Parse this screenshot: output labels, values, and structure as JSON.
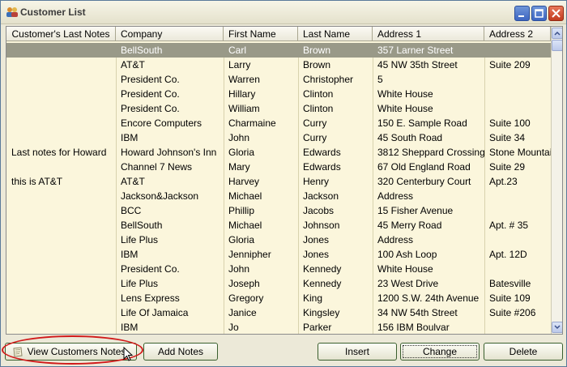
{
  "window": {
    "title": "Customer List"
  },
  "columns": [
    "Customer's Last Notes",
    "Company",
    "First Name",
    "Last Name",
    "Address 1",
    "Address 2"
  ],
  "rows": [
    [
      "",
      "BellSouth",
      "Carl",
      "Brown",
      "357 Larner Street",
      ""
    ],
    [
      "",
      "AT&T",
      "Larry",
      "Brown",
      "45 NW 35th Street",
      "Suite 209"
    ],
    [
      "",
      "President Co.",
      "Warren",
      "Christopher",
      "5",
      ""
    ],
    [
      "",
      "President Co.",
      "Hillary",
      "Clinton",
      "White House",
      ""
    ],
    [
      "",
      "President Co.",
      "William",
      "Clinton",
      "White House",
      ""
    ],
    [
      "",
      "Encore Computers",
      "Charmaine",
      "Curry",
      "150 E. Sample Road",
      "Suite 100"
    ],
    [
      "",
      "IBM",
      "John",
      "Curry",
      "45 South Road",
      "Suite 34"
    ],
    [
      "Last notes for Howard",
      "Howard Johnson's Inn",
      "Gloria",
      "Edwards",
      "3812 Sheppard Crossing",
      "Stone Mountain"
    ],
    [
      "",
      "Channel 7 News",
      "Mary",
      "Edwards",
      "67 Old England Road",
      "Suite 29"
    ],
    [
      "this is AT&T",
      "AT&T",
      "Harvey",
      "Henry",
      "320 Centerbury Court",
      "Apt.23"
    ],
    [
      "",
      "Jackson&Jackson",
      "Michael",
      "Jackson",
      "Address",
      ""
    ],
    [
      "",
      "BCC",
      "Phillip",
      "Jacobs",
      "15 Fisher Avenue",
      ""
    ],
    [
      "",
      "BellSouth",
      "Michael",
      "Johnson",
      "45 Merry Road",
      "Apt. # 35"
    ],
    [
      "",
      "Life Plus",
      "Gloria",
      "Jones",
      "Address",
      ""
    ],
    [
      "",
      "IBM",
      "Jennipher",
      "Jones",
      "100 Ash Loop",
      "Apt. 12D"
    ],
    [
      "",
      "President Co.",
      "John",
      "Kennedy",
      "White House",
      ""
    ],
    [
      "",
      "Life Plus",
      "Joseph",
      "Kennedy",
      "23 West Drive",
      "Batesville"
    ],
    [
      "",
      "Lens Express",
      "Gregory",
      "King",
      "1200 S.W. 24th Avenue",
      "Suite 109"
    ],
    [
      "",
      "Life Of Jamaica",
      "Janice",
      "Kingsley",
      "34 NW 54th Street",
      "Suite #206"
    ],
    [
      "",
      "IBM",
      "Jo",
      "Parker",
      "156 IBM Boulvar",
      ""
    ]
  ],
  "selected_row": 0,
  "buttons": {
    "view_notes": "View Customers Notes",
    "add_notes": "Add Notes",
    "insert": "Insert",
    "change": "Change",
    "delete": "Delete"
  },
  "colors": {
    "selection": "#999988",
    "grid_bg": "#fbf6dc",
    "highlight": "#d11a1a"
  }
}
